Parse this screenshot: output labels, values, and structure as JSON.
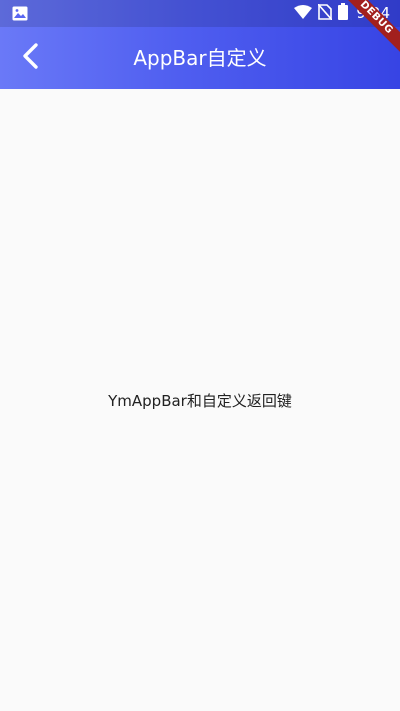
{
  "status_bar": {
    "time": "9:24",
    "icons": [
      "image-icon",
      "wifi-icon",
      "no-sim-icon",
      "battery-icon"
    ]
  },
  "app_bar": {
    "title": "AppBar自定义",
    "back_icon": "chevron-left-icon"
  },
  "debug_banner": {
    "label": "DEBUG"
  },
  "body": {
    "text": "YmAppBar和自定义返回键"
  },
  "colors": {
    "appbar_gradient_start": "#6a79f7",
    "appbar_gradient_end": "#3744e4",
    "background": "#fafafa",
    "text": "#212121",
    "debug": "#a2201e"
  }
}
